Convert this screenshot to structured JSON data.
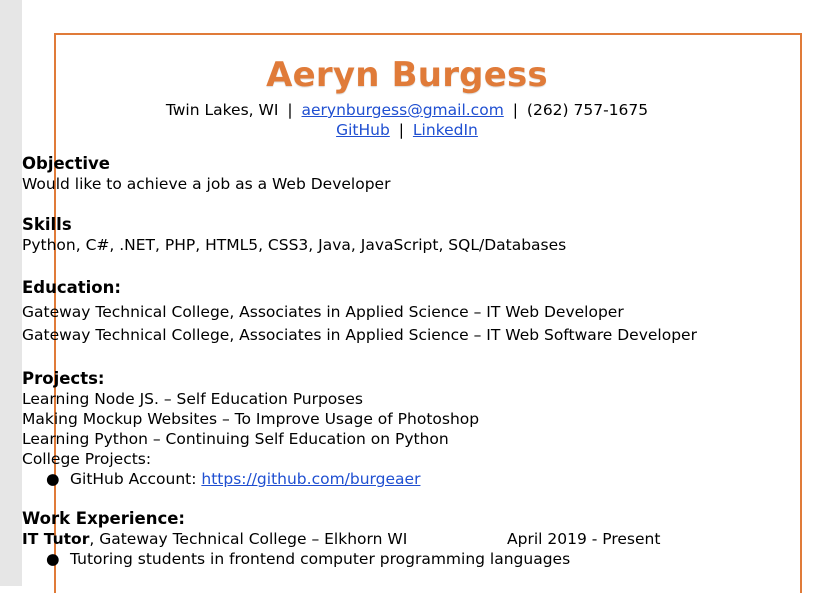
{
  "header": {
    "name": "Aeryn Burgess",
    "location": "Twin Lakes, WI",
    "separator": "|",
    "email": "aerynburgess@gmail.com",
    "phone": "(262) 757-1675",
    "github_label": "GitHub",
    "linkedin_label": "LinkedIn"
  },
  "objective": {
    "heading": "Objective",
    "text": "Would like to achieve a job as a Web Developer"
  },
  "skills": {
    "heading": "Skills",
    "text": "Python, C#, .NET, PHP, HTML5, CSS3, Java, JavaScript, SQL/Databases"
  },
  "education": {
    "heading": "Education:",
    "items": [
      "Gateway Technical College, Associates in Applied Science – IT Web Developer",
      "Gateway Technical College, Associates in Applied Science – IT Web Software Developer"
    ]
  },
  "projects": {
    "heading": "Projects:",
    "items": [
      "Learning Node JS. – Self Education Purposes",
      "Making Mockup Websites – To Improve Usage of Photoshop",
      "Learning Python – Continuing Self Education on Python",
      "College Projects:"
    ],
    "bullet": "●",
    "github_prefix": "GitHub Account: ",
    "github_url": "https://github.com/burgeaer"
  },
  "work": {
    "heading": "Work Experience:",
    "jobs": [
      {
        "title": "IT Tutor",
        "employer": ", Gateway Technical College – Elkhorn WI",
        "dates": "April 2019 - Present",
        "bullets": [
          "Tutoring students in frontend computer programming languages"
        ]
      }
    ]
  },
  "colors": {
    "accent": "#e07b39",
    "link": "#1f4fd1"
  }
}
